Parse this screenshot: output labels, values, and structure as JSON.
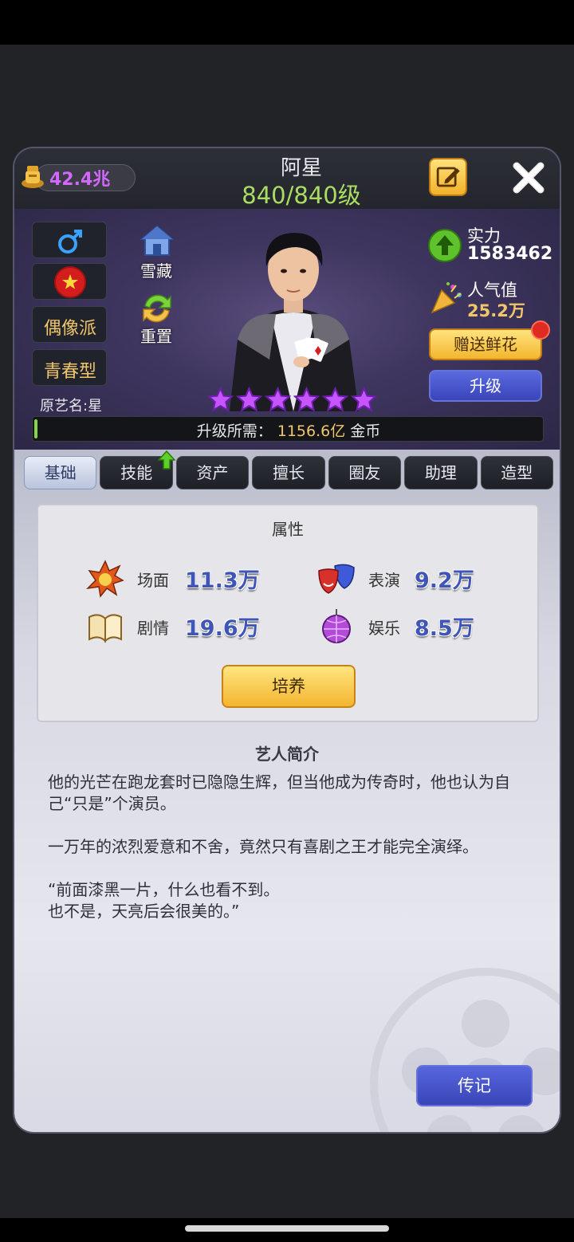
{
  "header": {
    "gold": "42.4兆",
    "name": "阿星",
    "level": "840/840级"
  },
  "profile": {
    "tags": [
      "偶像派",
      "青春型"
    ],
    "original_name": "原艺名:星",
    "hide_label": "雪藏",
    "reset_label": "重置",
    "stars": 6,
    "power_label": "实力",
    "power_value": "1583462",
    "popularity_label": "人气值",
    "popularity_value": "25.2万",
    "flower_button": "赠送鲜花",
    "upgrade_button": "升级",
    "upgrade_cost_label": "升级所需：",
    "upgrade_cost_value": "1156.6亿",
    "upgrade_cost_unit": "金币",
    "progress": 0
  },
  "tabs": [
    "基础",
    "技能",
    "资产",
    "擅长",
    "圈友",
    "助理",
    "造型"
  ],
  "attributes": {
    "title": "属性",
    "items": [
      {
        "label": "场面",
        "value": "11.3万",
        "icon": "explosion-icon"
      },
      {
        "label": "表演",
        "value": "9.2万",
        "icon": "theater-mask-icon"
      },
      {
        "label": "剧情",
        "value": "19.6万",
        "icon": "book-icon"
      },
      {
        "label": "娱乐",
        "value": "8.5万",
        "icon": "disco-ball-icon"
      }
    ],
    "train_button": "培养"
  },
  "bio": {
    "title": "艺人简介",
    "text": "他的光芒在跑龙套时已隐隐生辉，但当他成为传奇时，他也认为自己“只是”个演员。\n\n一万年的浓烈爱意和不舍，竟然只有喜剧之王才能完全演绎。\n\n“前面漆黑一片，什么也看不到。\n也不是，天亮后会很美的。”",
    "button": "传记"
  },
  "colors": {
    "gold": "#d268ff",
    "level": "#a9de63",
    "accent_yellow": "#f3b52f",
    "accent_blue": "#3a44b8",
    "value_blue": "#3f56b8"
  }
}
